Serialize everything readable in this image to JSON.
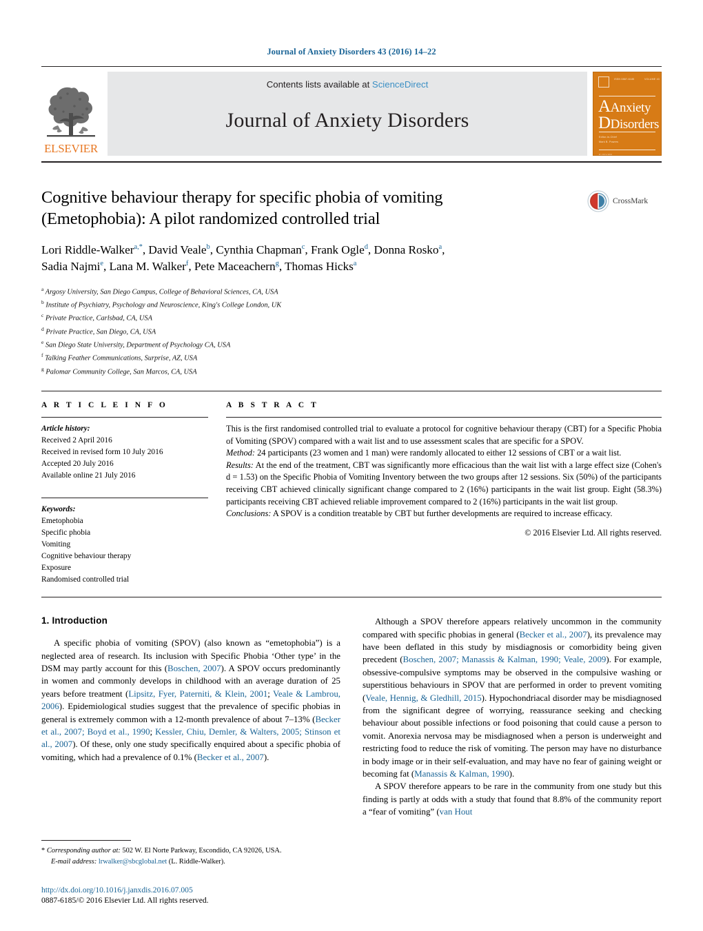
{
  "running_head": "Journal of Anxiety Disorders 43 (2016) 14–22",
  "masthead": {
    "contents_prefix": "Contents lists available at ",
    "sciencedirect": "ScienceDirect",
    "journal_title": "Journal of Anxiety Disorders",
    "publisher": "ELSEVIER",
    "cover": {
      "line1": "Anxiety",
      "line2": "Disorders",
      "cap1": "A",
      "cap2": "D"
    },
    "colors": {
      "link_blue": "#3b8fc4",
      "elsevier_orange": "#e87722",
      "cover_orange": "#d77b16",
      "masthead_grey": "#e6e7e8"
    }
  },
  "article": {
    "title": "Cognitive behaviour therapy for specific phobia of vomiting (Emetophobia): A pilot randomized controlled trial",
    "title_line1": "Cognitive behaviour therapy for specific phobia of vomiting",
    "title_line2": "(Emetophobia): A pilot randomized controlled trial",
    "crossmark_label": "CrossMark",
    "authors": [
      {
        "name": "Lori Riddle-Walker",
        "sup": "a,*"
      },
      {
        "name": "David Veale",
        "sup": "b"
      },
      {
        "name": "Cynthia Chapman",
        "sup": "c"
      },
      {
        "name": "Frank Ogle",
        "sup": "d"
      },
      {
        "name": "Donna Rosko",
        "sup": "a"
      },
      {
        "name": "Sadia Najmi",
        "sup": "e"
      },
      {
        "name": "Lana M. Walker",
        "sup": "f"
      },
      {
        "name": "Pete Maceachern",
        "sup": "g"
      },
      {
        "name": "Thomas Hicks",
        "sup": "a"
      }
    ],
    "affiliations": [
      {
        "mark": "a",
        "text": "Argosy University, San Diego Campus, College of Behavioral Sciences, CA, USA"
      },
      {
        "mark": "b",
        "text": "Institute of Psychiatry, Psychology and Neuroscience, King's College London, UK"
      },
      {
        "mark": "c",
        "text": "Private Practice, Carlsbad, CA, USA"
      },
      {
        "mark": "d",
        "text": "Private Practice, San Diego, CA, USA"
      },
      {
        "mark": "e",
        "text": "San Diego State University, Department of Psychology CA, USA"
      },
      {
        "mark": "f",
        "text": "Talking Feather Communications, Surprise, AZ, USA"
      },
      {
        "mark": "g",
        "text": "Palomar Community College, San Marcos, CA, USA"
      }
    ]
  },
  "article_info": {
    "heading": "A R T I C L E   I N F O",
    "history_label": "Article history:",
    "history": [
      "Received 2 April 2016",
      "Received in revised form 10 July 2016",
      "Accepted 20 July 2016",
      "Available online 21 July 2016"
    ],
    "keywords_label": "Keywords:",
    "keywords": [
      "Emetophobia",
      "Specific phobia",
      "Vomiting",
      "Cognitive behaviour therapy",
      "Exposure",
      "Randomised controlled trial"
    ]
  },
  "abstract": {
    "heading": "A B S T R A C T",
    "intro": "This is the first randomised controlled trial to evaluate a protocol for cognitive behaviour therapy (CBT) for a Specific Phobia of Vomiting (SPOV) compared with a wait list and to use assessment scales that are specific for a SPOV.",
    "method_label": "Method:",
    "method": " 24 participants (23 women and 1 man) were randomly allocated to either 12 sessions of CBT or a wait list.",
    "results_label": "Results:",
    "results": " At the end of the treatment, CBT was significantly more efficacious than the wait list with a large effect size (Cohen's d = 1.53) on the Specific Phobia of Vomiting Inventory between the two groups after 12 sessions. Six (50%) of the participants receiving CBT achieved clinically significant change compared to 2 (16%) participants in the wait list group. Eight (58.3%) participants receiving CBT achieved reliable improvement compared to 2 (16%) participants in the wait list group.",
    "conclusions_label": "Conclusions:",
    "conclusions": " A SPOV is a condition treatable by CBT but further developments are required to increase efficacy.",
    "copyright": "© 2016 Elsevier Ltd. All rights reserved."
  },
  "introduction": {
    "heading": "1.  Introduction",
    "left_para_1_a": "A specific phobia of vomiting (SPOV) (also known as “emetophobia”) is a neglected area of research. Its inclusion with Specific Phobia ‘Other type’ in the DSM may partly account for this (",
    "ref_boschen_2007": "Boschen, 2007",
    "left_para_1_b": "). A SPOV occurs predominantly in women and commonly develops in childhood with an average duration of 25 years before treatment (",
    "ref_lipsitz": "Lipsitz, Fyer, Paterniti, & Klein, 2001",
    "sep_semicolon": "; ",
    "ref_veale_lambrou": "Veale & Lambrou, 2006",
    "left_para_1_c": "). Epidemiological studies suggest that the prevalence of specific phobias in general is extremely common with a 12-month prevalence of about 7–13% (",
    "ref_becker_boyd": "Becker et al., 2007; Boyd et al., 1990",
    "ref_kessler_stinson": "Kessler, Chiu, Demler, & Walters, 2005; Stinson et al., 2007",
    "left_para_1_d": "). Of these, only one study specifically enquired about a specific phobia of vomiting, which had a prevalence of 0.1% (",
    "ref_becker_2007": "Becker et al., 2007",
    "left_para_1_e": ").",
    "right_para_1_a": "Although a SPOV therefore appears relatively uncommon in the community compared with specific phobias in general (",
    "ref_becker_etal_2007": "Becker et al., 2007",
    "right_para_1_b": "), its prevalence may have been deflated in this study by misdiagnosis or comorbidity being given precedent (",
    "ref_boschen_manassis_veale": "Boschen, 2007; Manassis & Kalman, 1990; Veale, 2009",
    "right_para_1_c": "). For example, obsessive-compulsive symptoms may be observed in the compulsive washing or superstitious behaviours in SPOV that are performed in order to prevent vomiting (",
    "ref_veale_hennig": "Veale, Hennig, & Gledhill, 2015",
    "right_para_1_d": "). Hypochondriacal disorder may be misdiagnosed from the significant degree of worrying, reassurance seeking and checking behaviour about possible infections or food poisoning that could cause a person to vomit. Anorexia nervosa may be misdiagnosed when a person is underweight and restricting food to reduce the risk of vomiting. The person may have no disturbance in body image or in their self-evaluation, and may have no fear of gaining weight or becoming fat (",
    "ref_manassis_kalman": "Manassis & Kalman, 1990",
    "right_para_1_e": ").",
    "right_para_2_a": "A SPOV therefore appears to be rare in the community from one study but this finding is partly at odds with a study that found that 8.8% of the community report a “fear of vomiting” (",
    "ref_van_hout": "van Hout"
  },
  "footer": {
    "corresponding_star": "*",
    "corresponding_label": "Corresponding author at:",
    "corresponding_address": " 502 W. El Norte Parkway, Escondido, CA 92026, USA.",
    "email_label": "E-mail address:",
    "email": "lrwalker@sbcglobal.net",
    "email_owner": " (L. Riddle-Walker).",
    "doi": "http://dx.doi.org/10.1016/j.janxdis.2016.07.005",
    "issn_line": "0887-6185/© 2016 Elsevier Ltd. All rights reserved."
  }
}
